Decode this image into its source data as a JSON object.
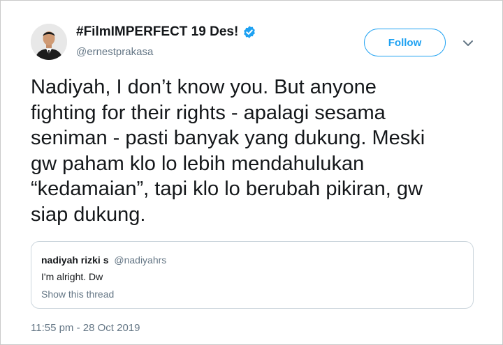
{
  "author": {
    "display_name": "#FilmIMPERFECT 19 Des!",
    "handle": "@ernestprakasa",
    "verified_icon": "verified-badge-icon",
    "avatar_icon": "avatar"
  },
  "actions": {
    "follow_label": "Follow",
    "menu_icon": "chevron-down-icon"
  },
  "tweet": {
    "lines": [
      "Nadiyah, I don’t know you. But anyone",
      "fighting for their rights - apalagi sesama",
      "seniman - pasti banyak yang dukung. Meski",
      "gw paham klo lo lebih mendahulukan",
      "“kedamaian”, tapi klo lo berubah pikiran, gw",
      "siap dukung."
    ],
    "timestamp": "11:55 pm - 28 Oct 2019"
  },
  "quoted_tweet": {
    "name": "nadiyah rizki s",
    "handle": "@nadiyahrs",
    "text": "I'm alright. Dw",
    "show_thread_label": "Show this thread"
  },
  "colors": {
    "accent": "#1da1f2",
    "secondary_text": "#657786",
    "primary_text": "#14171a",
    "border": "#ccd6dd"
  }
}
